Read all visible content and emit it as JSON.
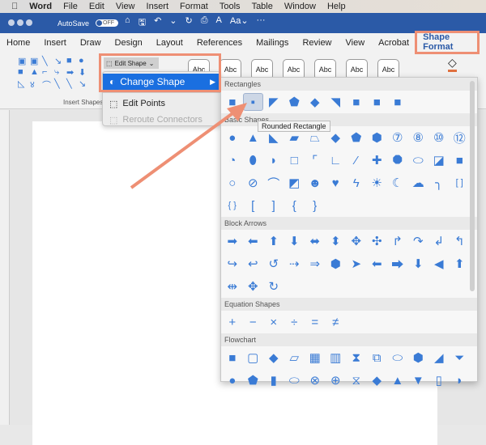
{
  "menubar": {
    "apple": "",
    "app": "Word",
    "items": [
      "File",
      "Edit",
      "View",
      "Insert",
      "Format",
      "Tools",
      "Table",
      "Window",
      "Help"
    ]
  },
  "titlebar": {
    "autosave": "AutoSave",
    "toggle": "OFF",
    "icons": [
      "⌂",
      "🖫",
      "↶",
      "⌄",
      "↻",
      "⎙",
      "A",
      "Aa⌄",
      "···"
    ]
  },
  "tabs": [
    "Home",
    "Insert",
    "Draw",
    "Design",
    "Layout",
    "References",
    "Mailings",
    "Review",
    "View",
    "Acrobat",
    "Shape Format"
  ],
  "active_tab": "Shape Format",
  "ribbon": {
    "insert_shapes_label": "Insert Shapes",
    "edit_shape": "Edit Shape",
    "style_sample": "Abc",
    "shape_glyphs": [
      "▣",
      "▣",
      "╲",
      "↘",
      "■",
      "●",
      "■",
      "▲",
      "⌐",
      "⤷",
      "➡",
      "⬇",
      "◺",
      "४",
      "⌒",
      "╲",
      "╲",
      "↘"
    ]
  },
  "menu": {
    "items": [
      {
        "label": "Change Shape",
        "state": "selected",
        "arrow": "▶"
      },
      {
        "label": "Edit Points",
        "state": "normal"
      },
      {
        "label": "Reroute Connectors",
        "state": "disabled"
      }
    ]
  },
  "tooltip": "Rounded Rectangle",
  "gallery": {
    "sections": [
      {
        "title": "Rectangles",
        "rows": [
          [
            "■",
            "▪",
            "◤",
            "⬟",
            "◆",
            "◥",
            "■",
            "■",
            "■"
          ]
        ]
      },
      {
        "title": "Basic Shapes",
        "rows": [
          [
            "●",
            "▲",
            "◣",
            "▰",
            "⏢",
            "◆",
            "⬟",
            "⬢",
            "⑦",
            "⑧",
            "⑩",
            "⑫"
          ],
          [
            "◔",
            "⬮",
            "◗",
            "□",
            "⌜",
            "∟",
            "⁄",
            "✚",
            "⯃",
            "⬭",
            "◪",
            "■"
          ],
          [
            "○",
            "⊘",
            "⌒",
            "◩",
            "☻",
            "♥",
            "ϟ",
            "☀",
            "☾",
            "☁",
            "╮",
            "[ ]"
          ],
          [
            "{ }",
            "[",
            "]",
            "{",
            "}"
          ]
        ]
      },
      {
        "title": "Block Arrows",
        "rows": [
          [
            "➡",
            "⬅",
            "⬆",
            "⬇",
            "⬌",
            "⬍",
            "✥",
            "✣",
            "↱",
            "↷",
            "↲",
            "↰"
          ],
          [
            "↪",
            "↩",
            "↺",
            "⇢",
            "⇒",
            "⬢",
            "➤",
            "⬅",
            "⮕",
            "⬇",
            "◀",
            "⬆"
          ],
          [
            "⇹",
            "✥",
            "↻"
          ]
        ]
      },
      {
        "title": "Equation Shapes",
        "rows": [
          [
            "+",
            "−",
            "×",
            "÷",
            "=",
            "≠"
          ]
        ]
      },
      {
        "title": "Flowchart",
        "rows": [
          [
            "■",
            "▢",
            "◆",
            "▱",
            "▦",
            "▥",
            "⧗",
            "⧉",
            "⬭",
            "⬢",
            "◢",
            "⏷"
          ],
          [
            "●",
            "⬟",
            "▮",
            "⬭",
            "⊗",
            "⊕",
            "⧖",
            "◆",
            "▲",
            "▼",
            "▯",
            "◗"
          ]
        ]
      }
    ]
  },
  "colors": {
    "accent": "#2b5aa7",
    "shape": "#3a7bd5",
    "highlight": "#ee8f74",
    "menu_selected": "#1a6fe0"
  }
}
